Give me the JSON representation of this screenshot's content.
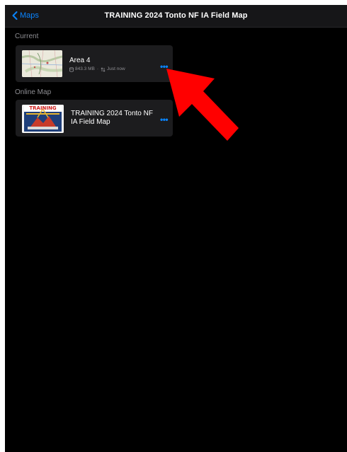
{
  "navbar": {
    "back_label": "Maps",
    "title": "TRAINING 2024 Tonto NF IA Field Map"
  },
  "sections": {
    "current": "Current",
    "online": "Online Map"
  },
  "current_item": {
    "title": "Area 4",
    "size": "843.3 MB",
    "sync": "Just now",
    "more_label": "•••"
  },
  "online_item": {
    "title_line1": "TRAINING 2024 Tonto NF",
    "title_line2": "IA Field Map",
    "badge_text": "TRAINING",
    "more_label": "•••"
  },
  "colors": {
    "accent": "#0a84ff",
    "background": "#000000",
    "card": "#1c1c1e",
    "annotation_arrow": "#ff0000"
  },
  "icons": [
    "chevron-left-icon",
    "storage-icon",
    "sync-icon",
    "more-icon",
    "annotation-arrow"
  ]
}
